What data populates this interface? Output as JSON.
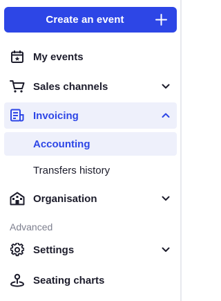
{
  "create_button": {
    "label": "Create an event"
  },
  "nav": {
    "my_events": {
      "label": "My events",
      "icon": "calendar-star-icon"
    },
    "sales_channels": {
      "label": "Sales channels",
      "icon": "cart-icon"
    },
    "invoicing": {
      "label": "Invoicing",
      "icon": "invoice-icon",
      "expanded": true
    },
    "invoicing_sub": [
      {
        "label": "Accounting",
        "active": true
      },
      {
        "label": "Transfers history",
        "active": false
      }
    ],
    "organisation": {
      "label": "Organisation",
      "icon": "house-icon"
    },
    "section_advanced": "Advanced",
    "settings": {
      "label": "Settings",
      "icon": "gear-icon"
    },
    "seating_charts": {
      "label": "Seating charts",
      "icon": "map-pin-icon"
    }
  },
  "colors": {
    "accent": "#2d46e6",
    "active_bg": "#eef0fb",
    "text": "#1c1c2b",
    "muted": "#7d7f8e"
  }
}
